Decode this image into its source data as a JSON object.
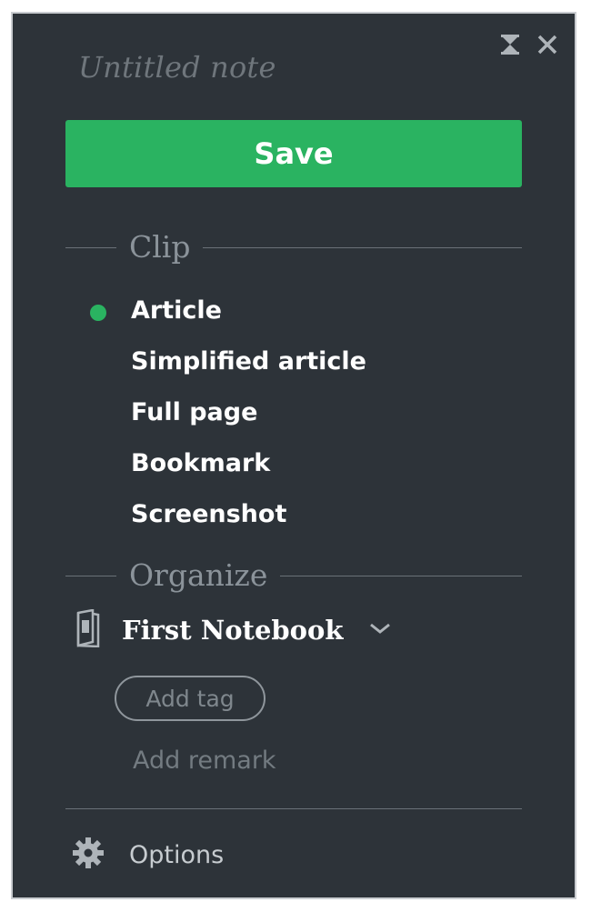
{
  "note": {
    "title_placeholder": "Untitled note"
  },
  "actions": {
    "save_label": "Save"
  },
  "clip": {
    "heading": "Clip",
    "selected": "Article",
    "options": [
      "Article",
      "Simplified article",
      "Full page",
      "Bookmark",
      "Screenshot"
    ]
  },
  "organize": {
    "heading": "Organize",
    "notebook": "First Notebook",
    "add_tag_label": "Add tag",
    "add_remark_label": "Add remark"
  },
  "footer": {
    "options_label": "Options"
  },
  "icons": {
    "collapse": "hourglass-icon",
    "close": "close-icon",
    "selected_marker": "green-dot-icon",
    "notebook": "notebook-icon",
    "dropdown": "chevron-down-icon",
    "options": "gear-icon"
  },
  "colors": {
    "panel_bg": "#2d3339",
    "accent": "#2ab361",
    "text_primary": "#ffffff",
    "text_muted": "#737b81"
  }
}
